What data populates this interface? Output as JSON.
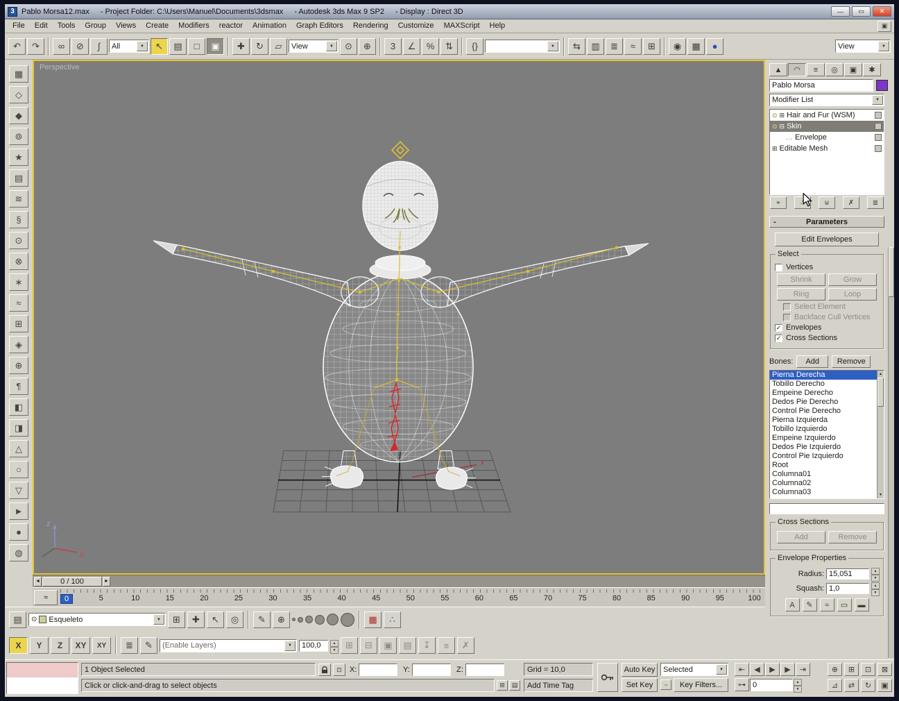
{
  "window": {
    "app_icon": "3",
    "title_parts": [
      "Pablo Morsa12.max",
      "- Project Folder: C:\\Users\\Manuel\\Documents\\3dsmax",
      "- Autodesk 3ds Max 9 SP2",
      "- Display : Direct 3D"
    ],
    "minimize": "—",
    "restore": "▭",
    "close": "✕"
  },
  "menu": {
    "items": [
      "File",
      "Edit",
      "Tools",
      "Group",
      "Views",
      "Create",
      "Modifiers",
      "reactor",
      "Animation",
      "Graph Editors",
      "Rendering",
      "Customize",
      "MAXScript",
      "Help"
    ],
    "end_icon": "▣"
  },
  "toolbar": {
    "selection_filter": "All",
    "ref_coord": "View",
    "named_sets": "",
    "view_combo": "View",
    "icons": [
      {
        "name": "undo",
        "glyph": "↶"
      },
      {
        "name": "redo",
        "glyph": "↷"
      },
      {
        "name": "select-link",
        "glyph": "∞"
      },
      {
        "name": "unlink-selection",
        "glyph": "⊘"
      },
      {
        "name": "bind-space-warp",
        "glyph": "∫"
      },
      {
        "name": "select-object",
        "glyph": "↖"
      },
      {
        "name": "select-by-name",
        "glyph": "▤"
      },
      {
        "name": "rect-selection-region",
        "glyph": "□"
      },
      {
        "name": "window-crossing",
        "glyph": "▣"
      },
      {
        "name": "select-move",
        "glyph": "✚"
      },
      {
        "name": "select-rotate",
        "glyph": "↻"
      },
      {
        "name": "select-scale",
        "glyph": "▱"
      },
      {
        "name": "use-pivot-point",
        "glyph": "⊙"
      },
      {
        "name": "select-manipulate",
        "glyph": "⊕"
      },
      {
        "name": "snap-toggle",
        "glyph": "3"
      },
      {
        "name": "angle-snap",
        "glyph": "∠"
      },
      {
        "name": "percent-snap",
        "glyph": "%"
      },
      {
        "name": "spinner-snap",
        "glyph": "⇅"
      },
      {
        "name": "edit-named-sets",
        "glyph": "{}"
      },
      {
        "name": "mirror",
        "glyph": "⇆"
      },
      {
        "name": "align",
        "glyph": "▥"
      },
      {
        "name": "layer-manager",
        "glyph": "≣"
      },
      {
        "name": "curve-editor",
        "glyph": "≈"
      },
      {
        "name": "schematic-view",
        "glyph": "⊞"
      },
      {
        "name": "material-editor",
        "glyph": "◉"
      },
      {
        "name": "render-setup",
        "glyph": "▦"
      },
      {
        "name": "quick-render",
        "glyph": "●"
      }
    ]
  },
  "left_toolbar": {
    "icons": [
      {
        "name": "reactor-rigid-body-collection",
        "glyph": "▦"
      },
      {
        "name": "reactor-cloth-collection",
        "glyph": "◇"
      },
      {
        "name": "reactor-soft-body-collection",
        "glyph": "◆"
      },
      {
        "name": "reactor-rope-collection",
        "glyph": "⊚"
      },
      {
        "name": "reactor-deforming-mesh-collection",
        "glyph": "★"
      },
      {
        "name": "reactor-plane",
        "glyph": "▤"
      },
      {
        "name": "reactor-water",
        "glyph": "≋"
      },
      {
        "name": "reactor-spring",
        "glyph": "§"
      },
      {
        "name": "reactor-linear-dashpot",
        "glyph": "⊙"
      },
      {
        "name": "reactor-angular-dashpot",
        "glyph": "⊗"
      },
      {
        "name": "reactor-motor",
        "glyph": "∗"
      },
      {
        "name": "reactor-wind",
        "glyph": "≈"
      },
      {
        "name": "reactor-toy-car",
        "glyph": "⊞"
      },
      {
        "name": "reactor-fracture",
        "glyph": "◈"
      },
      {
        "name": "reactor-constraint-solver",
        "glyph": "⊕"
      },
      {
        "name": "reactor-rag-doll-constraint",
        "glyph": "¶"
      },
      {
        "name": "reactor-hinge-constraint",
        "glyph": "◧"
      },
      {
        "name": "reactor-point-point-constraint",
        "glyph": "◨"
      },
      {
        "name": "reactor-prismatic-constraint",
        "glyph": "△"
      },
      {
        "name": "reactor-car-wheel-constraint",
        "glyph": "○"
      },
      {
        "name": "reactor-point-path-constraint",
        "glyph": "▽"
      },
      {
        "name": "reactor-preview-animation",
        "glyph": "►"
      },
      {
        "name": "reactor-create-animation",
        "glyph": "●"
      },
      {
        "name": "reactor-analyze-world",
        "glyph": "◍"
      }
    ]
  },
  "viewport": {
    "label": "Perspective",
    "axis_z": "z",
    "axis_x": "x"
  },
  "timeline": {
    "slider_label": "0 / 100",
    "slider_left": "◄",
    "slider_right": "►",
    "mini_curve_editor": "≈",
    "ticks": [
      "0",
      "5",
      "10",
      "15",
      "20",
      "25",
      "30",
      "35",
      "40",
      "45",
      "50",
      "55",
      "60",
      "65",
      "70",
      "75",
      "80",
      "85",
      "90",
      "95",
      "100"
    ]
  },
  "layer_bar": {
    "filters_glyph": "▤",
    "eye_glyph": "⊙",
    "layer_name": "Esqueleto",
    "new_layer": "⊞",
    "add_to_layer": "✚",
    "select_in_layer": "↖",
    "current_layer": "◎",
    "brush_manager": "✎",
    "add_brush": "⊕",
    "render_preset": "▦",
    "particle_view": "∴",
    "axis_x": "X",
    "axis_y": "Y",
    "axis_z": "Z",
    "axis_xy": "XY",
    "axis_plane": "XY",
    "layer_props": "≣",
    "edit_glyph": "✎",
    "anim_combo": "(Enable Layers)",
    "weight": "100,0",
    "anim_btns": [
      "⊞",
      "⊟",
      "▣",
      "▤",
      "↧",
      "≡",
      "✗"
    ]
  },
  "status": {
    "selection": "1 Object Selected",
    "prompt": "Click or click-and-drag to select objects",
    "grid": "Grid = 10,0",
    "time_tag": "Add Time Tag",
    "x_label": "X:",
    "y_label": "Y:",
    "z_label": "Z:",
    "x_value": "",
    "y_value": "",
    "z_value": "",
    "info_icon": "⊞",
    "mouse_icon": "▤",
    "abs_offset_icon": "⊡"
  },
  "anim": {
    "auto_key": "Auto Key",
    "set_key": "Set Key",
    "selected": "Selected",
    "key_filters": "Key Filters...",
    "frame": "0",
    "go_start": "⇤",
    "prev_frame": "◀",
    "play": "▶",
    "next_frame": "▶",
    "go_end": "⇥",
    "key_mode": "⊶",
    "nav": [
      {
        "name": "zoom",
        "glyph": "⊕"
      },
      {
        "name": "zoom-all",
        "glyph": "⊞"
      },
      {
        "name": "zoom-extents",
        "glyph": "⊡"
      },
      {
        "name": "zoom-extents-all",
        "glyph": "⊠"
      },
      {
        "name": "field-of-view",
        "glyph": "⊿"
      },
      {
        "name": "pan-view",
        "glyph": "⇄"
      },
      {
        "name": "arc-rotate",
        "glyph": "↻"
      },
      {
        "name": "maximize-viewport",
        "glyph": "▣"
      }
    ]
  },
  "panel": {
    "object_name": "Pablo Morsa",
    "modifier_list": "Modifier List",
    "tabs": [
      {
        "name": "create-tab",
        "glyph": "▲"
      },
      {
        "name": "modify-tab",
        "glyph": "◠"
      },
      {
        "name": "hierarchy-tab",
        "glyph": "≡"
      },
      {
        "name": "motion-tab",
        "glyph": "◎"
      },
      {
        "name": "display-tab",
        "glyph": "▣"
      },
      {
        "name": "utilities-tab",
        "glyph": "✱"
      }
    ],
    "stack_icons": {
      "bulb": "⊙",
      "expand": "⊞",
      "collapse": "⊟",
      "tree": "…"
    },
    "stack": [
      "Hair and Fur (WSM)",
      "Skin",
      "Envelope",
      "Editable Mesh"
    ],
    "stack_tools": [
      {
        "name": "pin-stack",
        "glyph": "⌖"
      },
      {
        "name": "show-end-result",
        "glyph": "∴"
      },
      {
        "name": "make-unique",
        "glyph": "⊎"
      },
      {
        "name": "remove-modifier",
        "glyph": "✗"
      },
      {
        "name": "configure-modifier-sets",
        "glyph": "≣"
      }
    ],
    "parameters": "Parameters",
    "edit_envelopes": "Edit Envelopes",
    "select": {
      "title": "Select",
      "vertices": "Vertices",
      "shrink": "Shrink",
      "grow": "Grow",
      "ring": "Ring",
      "loop": "Loop",
      "select_element": "Select Element",
      "backface": "Backface Cull Vertices",
      "envelopes": "Envelopes",
      "cross_sections": "Cross Sections",
      "vertices_check": "",
      "select_element_check": "",
      "backface_check": "",
      "envelopes_check": "✓",
      "cross_sections_check": "✓"
    },
    "bones_label": "Bones:",
    "add": "Add",
    "remove": "Remove",
    "bones": [
      "Pierna Derecha",
      "Tobillo Derecho",
      "Empeine Derecho",
      "Dedos Pie Derecho",
      "Control Pie Derecho",
      "Pierna Izquierda",
      "Tobillo Izquierdo",
      "Empeine Izquierdo",
      "Dedos Pie Izquierdo",
      "Control Pie Izquierdo",
      "Root",
      "Columna01",
      "Columna02",
      "Columna03"
    ],
    "cross": {
      "title": "Cross Sections",
      "add": "Add",
      "remove": "Remove"
    },
    "env": {
      "title": "Envelope Properties",
      "radius_label": "Radius:",
      "radius": "15,051",
      "squash_label": "Squash:",
      "squash": "1,0"
    },
    "env_icons": [
      {
        "name": "absolute-effect",
        "glyph": "A"
      },
      {
        "name": "paint-weights",
        "glyph": "✎"
      },
      {
        "name": "paint-options",
        "glyph": "≈"
      },
      {
        "name": "copy-envelope",
        "glyph": "▭"
      },
      {
        "name": "paste-envelope",
        "glyph": "▬"
      }
    ]
  },
  "colors": {
    "active_viewport_border": "#e6c52f",
    "selection_blue": "#2e5fc2",
    "viewport_bg": "#7d7d7d",
    "bone_yellow": "#ddbf2e",
    "selected_bone_red": "#d42a2a"
  }
}
